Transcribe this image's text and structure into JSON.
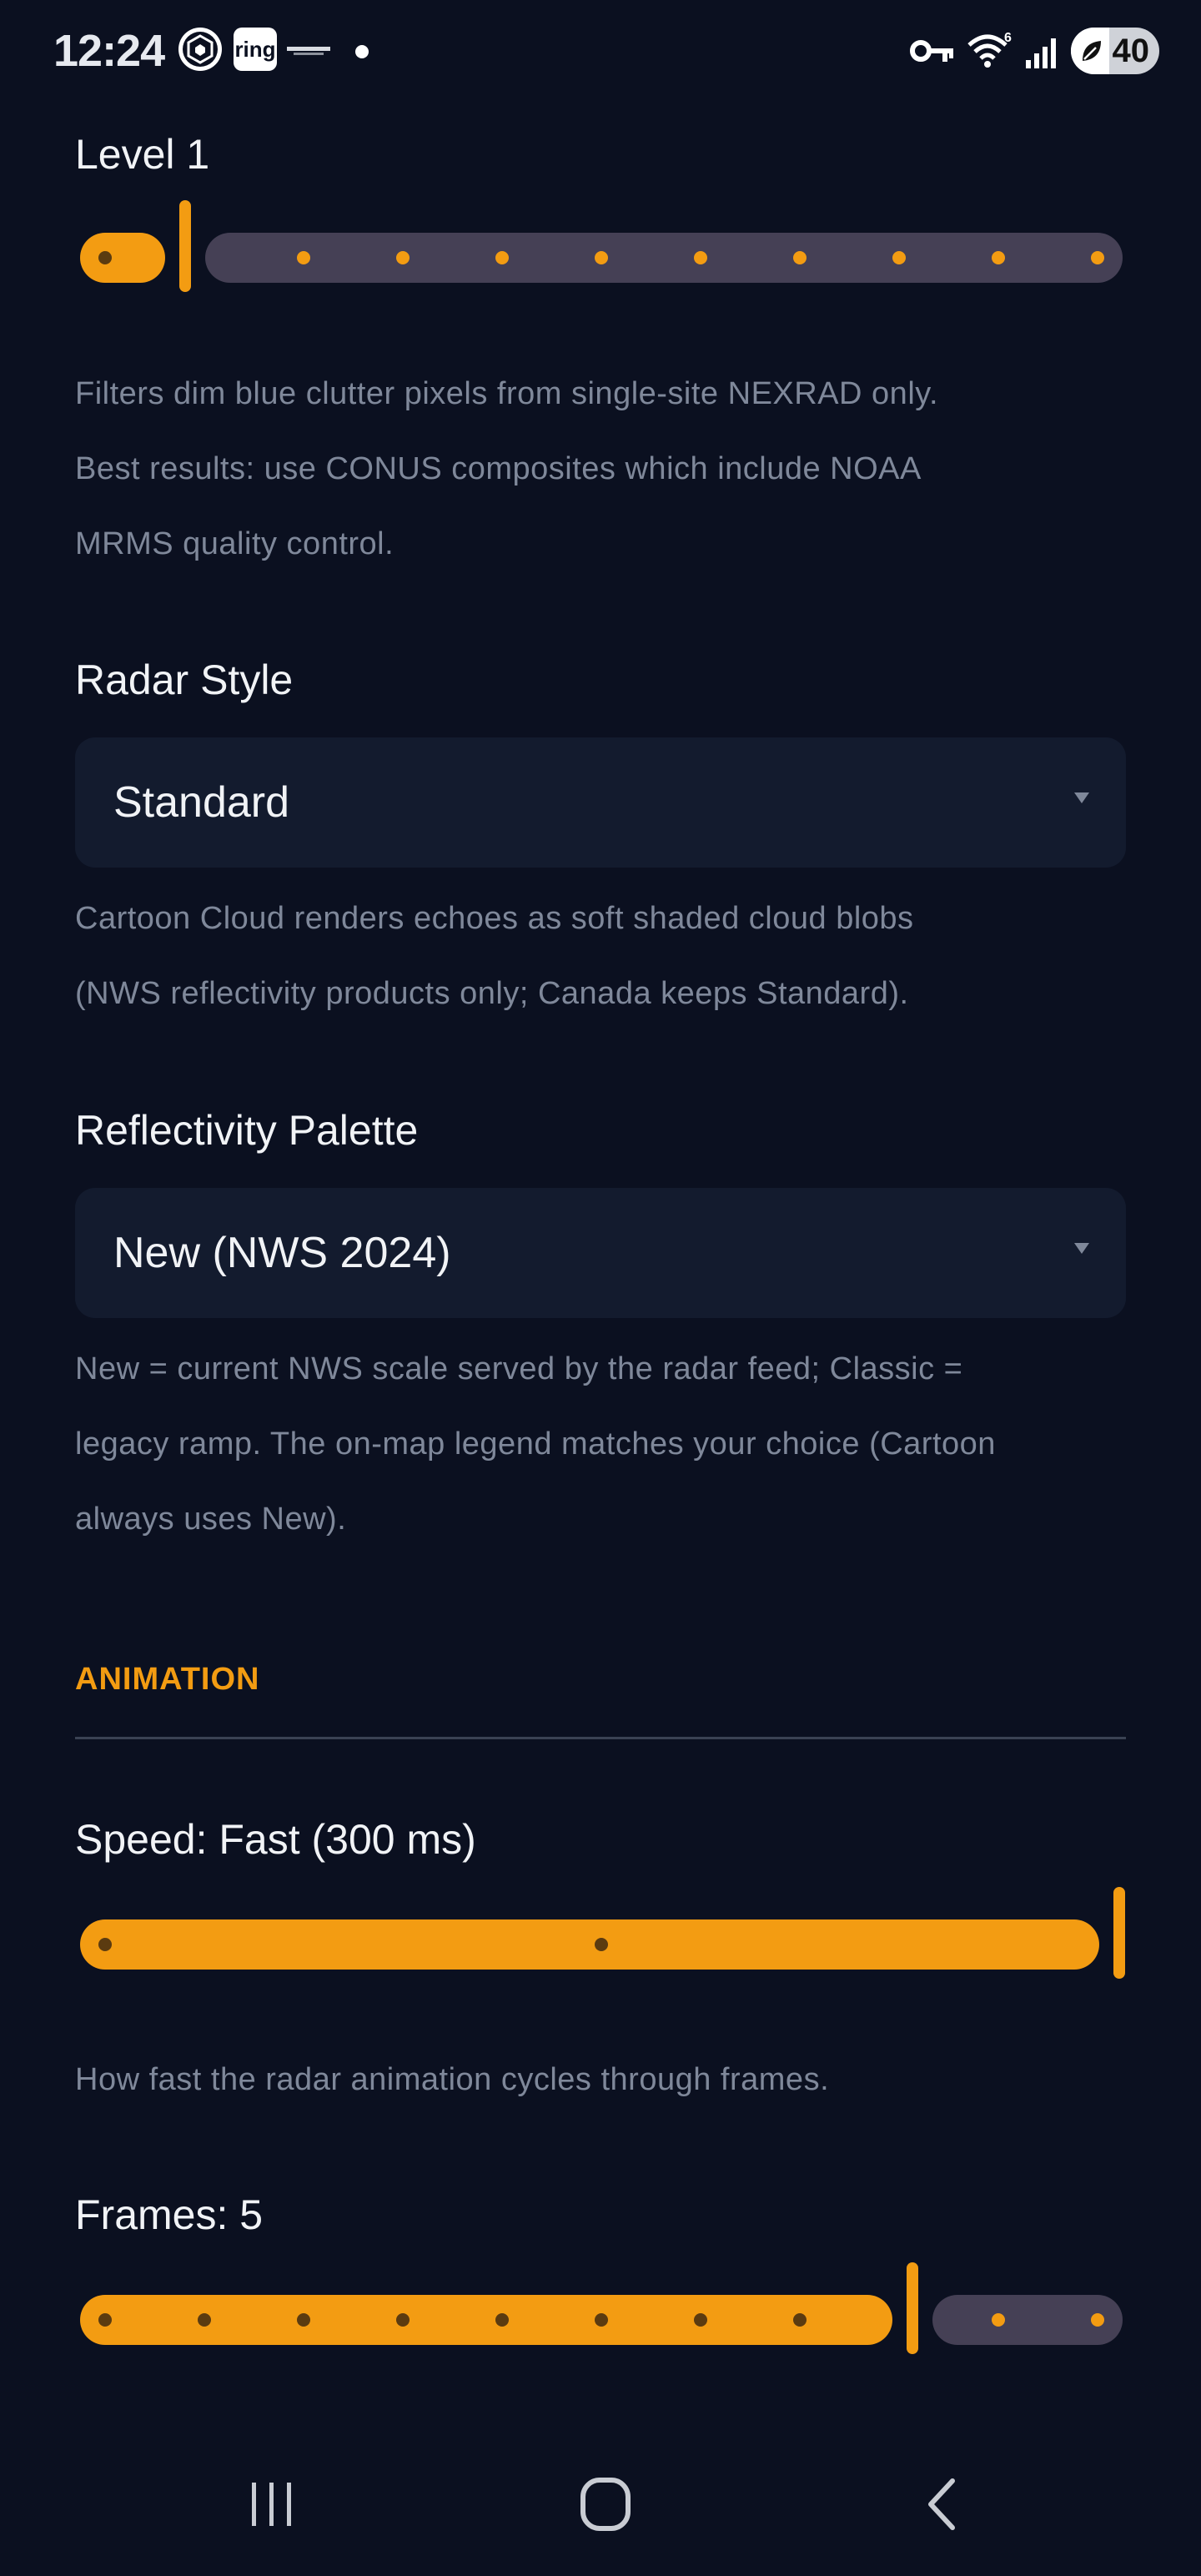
{
  "status_bar": {
    "time": "12:24",
    "ring_label": "ring",
    "battery": "40",
    "icons": [
      "crypto-com-icon",
      "ring-icon",
      "camera-brand-icon",
      "notification-dot-icon",
      "vpn-key-icon",
      "wifi-6-icon",
      "signal-icon",
      "battery-icon"
    ]
  },
  "filter": {
    "label": "Level 1",
    "value": 1,
    "min": 0,
    "max": 10,
    "help": [
      "Filters dim blue clutter pixels from single-site NEXRAD only.",
      "Best results: use CONUS composites which include NOAA",
      "MRMS quality control."
    ]
  },
  "radar_style": {
    "label": "Radar Style",
    "value": "Standard",
    "help": [
      "Cartoon Cloud renders echoes as soft shaded cloud blobs",
      "(NWS reflectivity products only; Canada keeps Standard)."
    ]
  },
  "palette": {
    "label": "Reflectivity Palette",
    "value": "New (NWS 2024)",
    "help": [
      "New = current NWS scale served by the radar feed; Classic =",
      "legacy ramp. The on-map legend matches your choice (Cartoon",
      "always uses New)."
    ]
  },
  "animation": {
    "section_title": "ANIMATION",
    "speed": {
      "label": "Speed: Fast (300 ms)",
      "value": 2,
      "min": 0,
      "max": 2,
      "help": "How fast the radar animation cycles through frames."
    },
    "frames": {
      "label": "Frames: 5",
      "value": 5,
      "min": 1,
      "max": 11
    }
  },
  "colors": {
    "accent": "#f39c12",
    "background": "#0b1020",
    "track_inactive": "#454055",
    "help_text": "#7f889a"
  },
  "nav_bar": {
    "icons": [
      "recent-apps-icon",
      "home-icon",
      "back-icon"
    ]
  }
}
